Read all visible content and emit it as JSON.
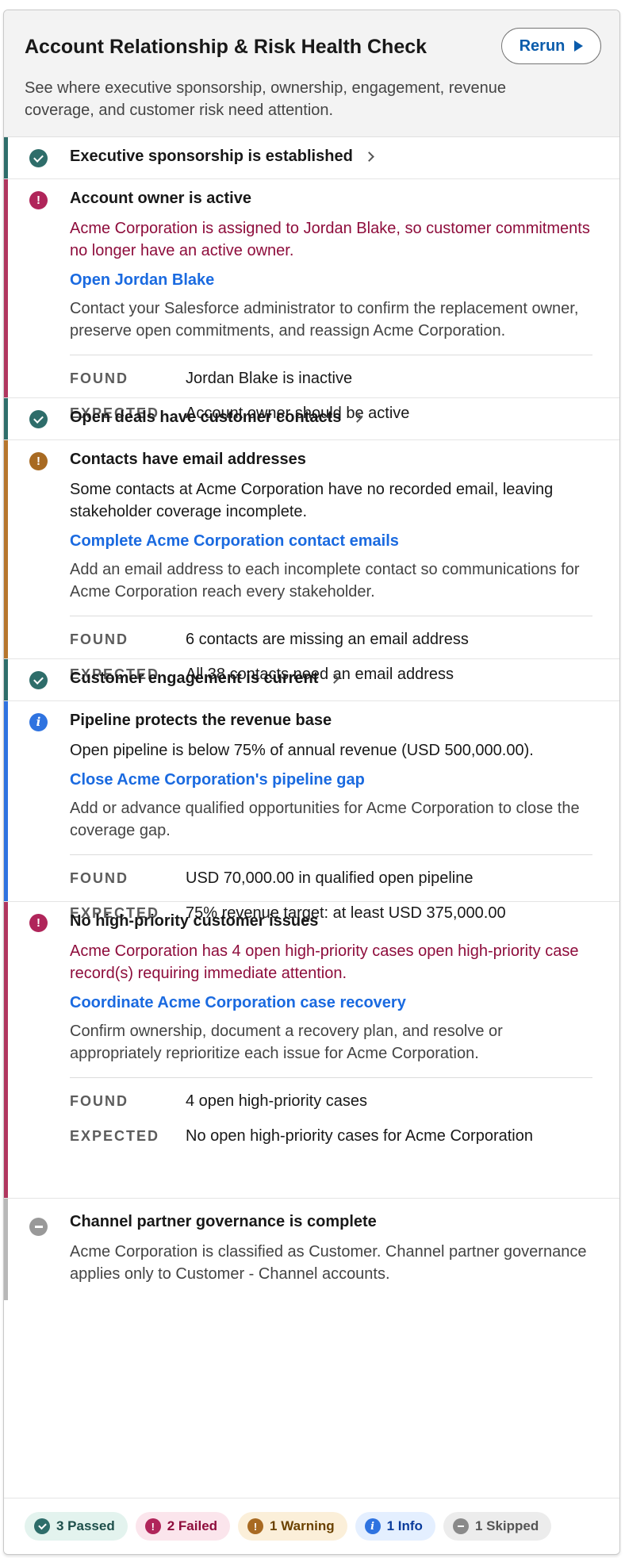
{
  "header": {
    "title": "Account Relationship & Risk Health Check",
    "description": "See where executive sponsorship, ownership, engagement, revenue coverage, and customer risk need attention.",
    "rerun_label": "Rerun"
  },
  "labels": {
    "found": "FOUND",
    "expected": "EXPECTED"
  },
  "checks": [
    {
      "status": "pass",
      "title": "Executive sponsorship is established"
    },
    {
      "status": "fail",
      "title": "Account owner is active",
      "message": "Acme Corporation is assigned to Jordan Blake, so customer commitments no longer have an active owner.",
      "link": "Open Jordan Blake",
      "help": "Contact your Salesforce administrator to confirm the replacement owner, preserve open commitments, and reassign Acme Corporation.",
      "found": "Jordan Blake is inactive",
      "expected": "Account owner should be active"
    },
    {
      "status": "pass",
      "title": "Open deals have customer contacts"
    },
    {
      "status": "warn",
      "title": "Contacts have email addresses",
      "message": "Some contacts at Acme Corporation have no recorded email, leaving stakeholder coverage incomplete.",
      "link": "Complete Acme Corporation contact emails",
      "help": "Add an email address to each incomplete contact so communications for Acme Corporation reach every stakeholder.",
      "found": "6 contacts are missing an email address",
      "expected": "All 38 contacts need an email address"
    },
    {
      "status": "pass",
      "title": "Customer engagement is current"
    },
    {
      "status": "info",
      "title": "Pipeline protects the revenue base",
      "message": "Open pipeline is below 75% of annual revenue (USD 500,000.00).",
      "link": "Close Acme Corporation's pipeline gap",
      "help": "Add or advance qualified opportunities for Acme Corporation to close the coverage gap.",
      "found": "USD 70,000.00 in qualified open pipeline",
      "expected": "75% revenue target: at least USD 375,000.00"
    },
    {
      "status": "fail",
      "title": "No high-priority customer issues",
      "message": "Acme Corporation has 4 open high-priority cases open high-priority case record(s) requiring immediate attention.",
      "link": "Coordinate Acme Corporation case recovery",
      "help": "Confirm ownership, document a recovery plan, and resolve or appropriately reprioritize each issue for Acme Corporation.",
      "found": "4 open high-priority cases",
      "expected": "No open high-priority cases for Acme Corporation"
    },
    {
      "status": "skip",
      "title": "Channel partner governance is complete",
      "message": "Acme Corporation is classified as Customer. Channel partner governance applies only to Customer - Channel accounts."
    }
  ],
  "summary": {
    "passed": "3 Passed",
    "failed": "2 Failed",
    "warning": "1 Warning",
    "info": "1 Info",
    "skipped": "1 Skipped"
  },
  "icons": {
    "pass": "check-circle-icon",
    "fail": "exclamation-circle-icon",
    "warn": "exclamation-circle-icon",
    "info": "info-circle-icon",
    "skip": "minus-circle-icon",
    "rerun": "play-icon",
    "expand": "chevron-right-icon"
  },
  "colors": {
    "pass": "#2e6d6a",
    "fail": "#b0255a",
    "warn": "#a86a22",
    "info": "#2f73e0",
    "skip": "#999999",
    "link": "#1a6ae0",
    "error_text": "#8e0d3c"
  }
}
